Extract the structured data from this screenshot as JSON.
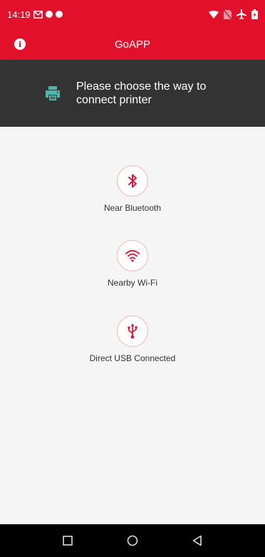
{
  "status_bar": {
    "time": "14:19",
    "left_icons": [
      "mail-icon",
      "notification-dot-icon",
      "notification-dot-icon"
    ],
    "right_icons": [
      "wifi-icon",
      "no-sim-icon",
      "airplane-icon",
      "battery-icon"
    ]
  },
  "app_bar": {
    "title": "GoAPP",
    "info_icon": "info-icon",
    "info_glyph": "i"
  },
  "banner": {
    "icon": "printer-icon",
    "text": "Please choose the way to connect printer"
  },
  "options": [
    {
      "icon": "bluetooth-icon",
      "label": "Near Bluetooth"
    },
    {
      "icon": "wifi-icon",
      "label": "Nearby Wi-Fi"
    },
    {
      "icon": "usb-icon",
      "label": "Direct USB Connected"
    }
  ],
  "nav_bar": {
    "buttons": [
      "recents-button",
      "home-button",
      "back-button"
    ]
  },
  "colors": {
    "brand": "#e3102b",
    "banner_bg": "#333333",
    "printer_icon": "#4db6ac",
    "background": "#f5f5f5"
  }
}
